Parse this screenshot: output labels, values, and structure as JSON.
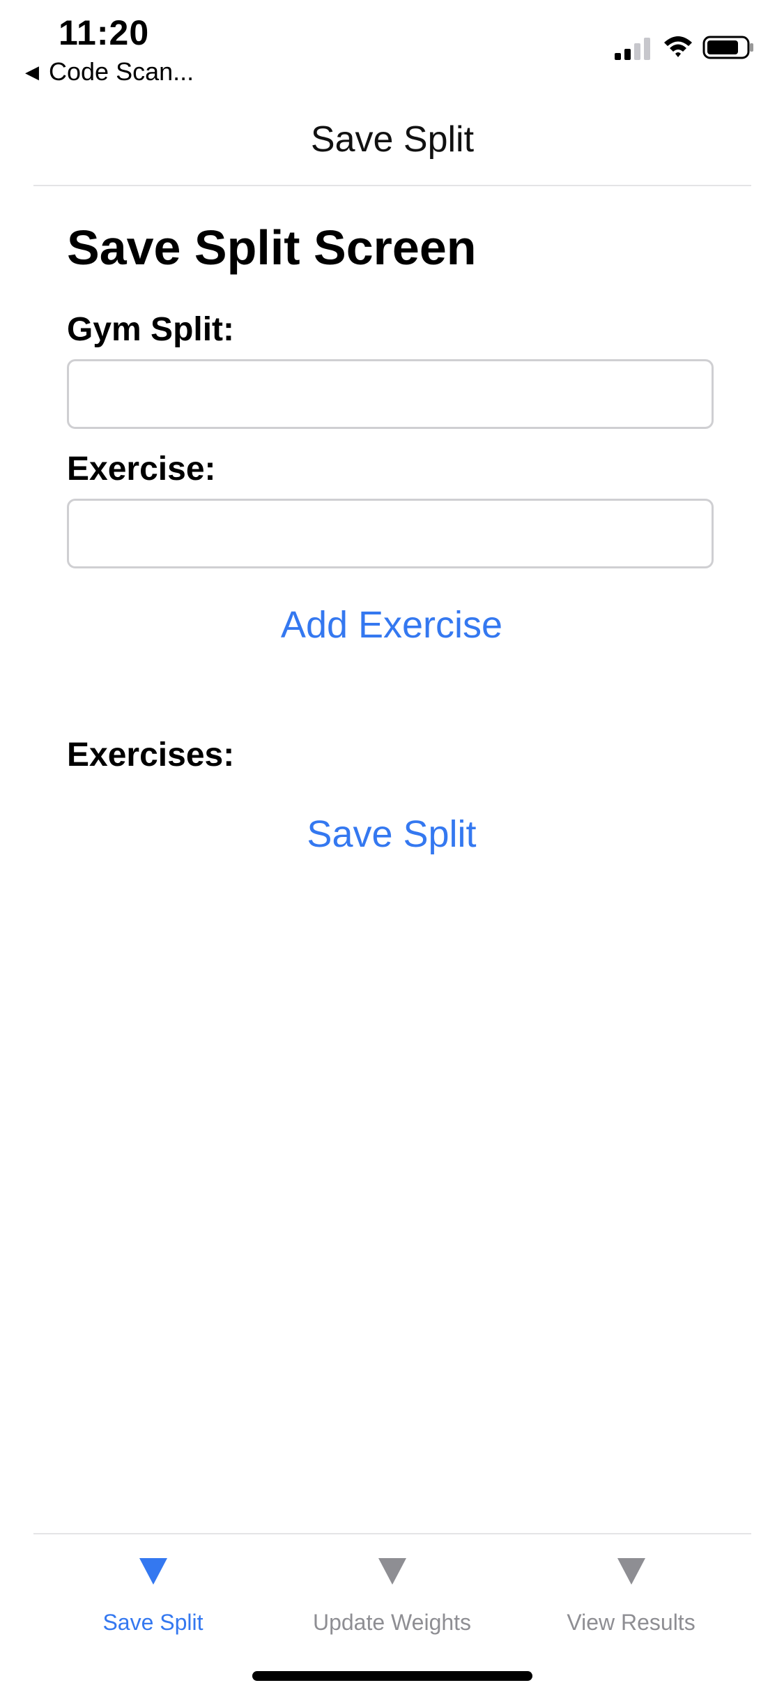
{
  "status_bar": {
    "time": "11:20",
    "back_app": "Code Scan...",
    "back_icon": "triangle-left-icon",
    "icons": [
      "signal-icon",
      "wifi-icon",
      "battery-icon"
    ]
  },
  "nav": {
    "title": "Save Split"
  },
  "main": {
    "page_title": "Save Split Screen",
    "gym_split_label": "Gym Split:",
    "gym_split_value": "",
    "exercise_label": "Exercise:",
    "exercise_value": "",
    "add_exercise_label": "Add Exercise",
    "exercises_label": "Exercises:",
    "save_split_label": "Save Split"
  },
  "tab_bar": {
    "tabs": [
      {
        "label": "Save Split",
        "active": true,
        "icon": "triangle-down-icon"
      },
      {
        "label": "Update Weights",
        "active": false,
        "icon": "triangle-down-icon"
      },
      {
        "label": "View Results",
        "active": false,
        "icon": "triangle-down-icon"
      }
    ]
  },
  "colors": {
    "accent": "#3478f0",
    "inactive": "#8e8e93",
    "border": "#cfcfd2"
  }
}
